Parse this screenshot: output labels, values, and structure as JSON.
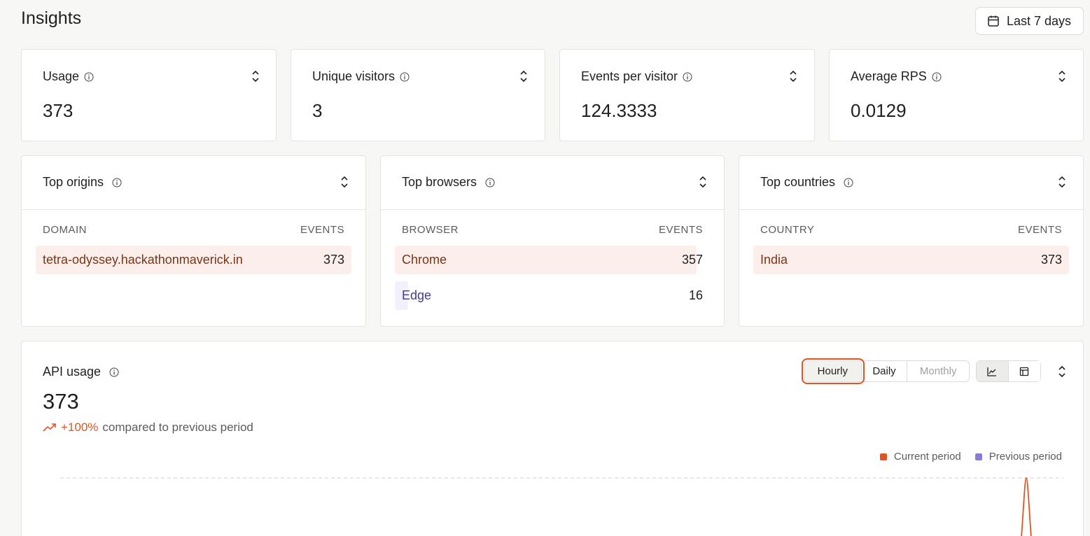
{
  "page": {
    "title": "Insights"
  },
  "date_range": {
    "label": "Last 7 days",
    "icon": "calendar-icon"
  },
  "stats": [
    {
      "title": "Usage",
      "value": "373"
    },
    {
      "title": "Unique visitors",
      "value": "3"
    },
    {
      "title": "Events per visitor",
      "value": "124.3333"
    },
    {
      "title": "Average RPS",
      "value": "0.0129"
    }
  ],
  "top_origins": {
    "title": "Top origins",
    "col_left": "DOMAIN",
    "col_right": "EVENTS",
    "rows": [
      {
        "label": "tetra-odyssey.hackathonmaverick.in",
        "value": "373",
        "share": 1.0
      }
    ]
  },
  "top_browsers": {
    "title": "Top browsers",
    "col_left": "BROWSER",
    "col_right": "EVENTS",
    "rows": [
      {
        "label": "Chrome",
        "value": "357",
        "share": 0.957
      },
      {
        "label": "Edge",
        "value": "16",
        "share": 0.043
      }
    ]
  },
  "top_countries": {
    "title": "Top countries",
    "col_left": "COUNTRY",
    "col_right": "EVENTS",
    "rows": [
      {
        "label": "India",
        "value": "373",
        "share": 1.0
      }
    ]
  },
  "api_usage": {
    "title": "API usage",
    "value": "373",
    "change_pct": "+100%",
    "change_text": "compared to previous period",
    "granularity": [
      "Hourly",
      "Daily",
      "Monthly"
    ],
    "active_granularity": "Hourly",
    "view_icons": [
      "line-chart-icon",
      "table-icon"
    ],
    "legend": {
      "current": "Current period",
      "previous": "Previous period"
    }
  },
  "colors": {
    "accent": "#e0541f",
    "previous": "#8b7ad8",
    "row_orange_bg": "#fcefeb",
    "row_orange_text": "#7a3515",
    "row_purple_bg": "#f2f0fb",
    "row_purple_text": "#4a3a8a"
  }
}
